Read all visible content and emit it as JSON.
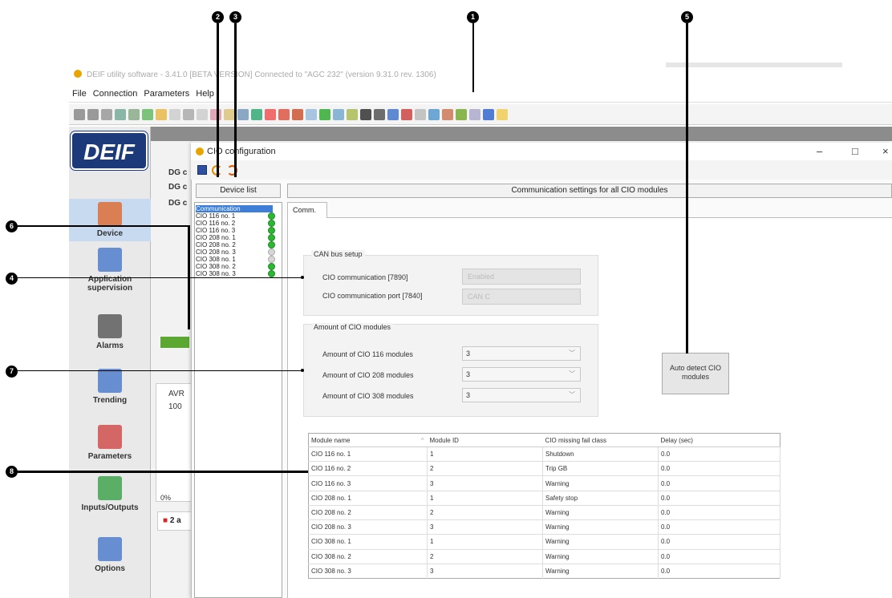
{
  "app": {
    "title": "DEIF utility software - 3.41.0 [BETA VERSION] Connected to \"AGC 232\" (version 9.31.0 rev. 1306)",
    "menu": [
      "File",
      "Connection",
      "Parameters",
      "Help"
    ],
    "logo_text": "DEIF"
  },
  "nav": {
    "items": [
      {
        "label": "Device",
        "icon": "device-icon",
        "active": true
      },
      {
        "label": "Application supervision",
        "icon": "application-supervision-icon",
        "active": false
      },
      {
        "label": "Alarms",
        "icon": "alarms-icon",
        "active": false
      },
      {
        "label": "Trending",
        "icon": "trending-icon",
        "active": false
      },
      {
        "label": "Parameters",
        "icon": "parameters-icon",
        "active": false
      },
      {
        "label": "Inputs/Outputs",
        "icon": "inputs-outputs-icon",
        "active": false
      },
      {
        "label": "Options",
        "icon": "options-icon",
        "active": false
      }
    ]
  },
  "bg_window": {
    "labels": [
      "DG c",
      "DG c",
      "DG c",
      "AVR",
      "100",
      "0%",
      "2 a"
    ]
  },
  "dialog": {
    "title": "CIO configuration",
    "controls": {
      "minimize": "–",
      "maximize": "□",
      "close": "×"
    },
    "device_list_header": "Device list",
    "device_list": [
      {
        "label": "Communication",
        "selected": true,
        "status": null
      },
      {
        "label": "CIO 116 no. 1",
        "selected": false,
        "status": "ok"
      },
      {
        "label": "CIO 116 no. 2",
        "selected": false,
        "status": "ok"
      },
      {
        "label": "CIO 116 no. 3",
        "selected": false,
        "status": "ok"
      },
      {
        "label": "CIO 208 no. 1",
        "selected": false,
        "status": "ok"
      },
      {
        "label": "CIO 208 no. 2",
        "selected": false,
        "status": "ok"
      },
      {
        "label": "CIO 208 no. 3",
        "selected": false,
        "status": "off"
      },
      {
        "label": "CIO 308 no. 1",
        "selected": false,
        "status": "off"
      },
      {
        "label": "CIO 308 no. 2",
        "selected": false,
        "status": "ok"
      },
      {
        "label": "CIO 308 no. 3",
        "selected": false,
        "status": "ok"
      }
    ],
    "comm_header": "Communication settings for all CIO modules",
    "tab": "Comm.",
    "can_bus": {
      "title": "CAN bus setup",
      "comm_label": "CIO communication [7890]",
      "comm_value": "Enabled",
      "port_label": "CIO communication port [7840]",
      "port_value": "CAN C"
    },
    "amount": {
      "title": "Amount of CIO modules",
      "rows": [
        {
          "label": "Amount of CIO 116 modules",
          "value": "3"
        },
        {
          "label": "Amount of CIO 208 modules",
          "value": "3"
        },
        {
          "label": "Amount of CIO 308 modules",
          "value": "3"
        }
      ]
    },
    "auto_detect_label": "Auto detect CIO modules",
    "table": {
      "headers": [
        "Module name",
        "Module ID",
        "CIO missing fail class",
        "Delay (sec)"
      ],
      "rows": [
        [
          "CIO 116 no. 1",
          "1",
          "Shutdown",
          "0.0"
        ],
        [
          "CIO 116 no. 2",
          "2",
          "Trip GB",
          "0.0"
        ],
        [
          "CIO 116 no. 3",
          "3",
          "Warning",
          "0.0"
        ],
        [
          "CIO 208 no. 1",
          "1",
          "Safety stop",
          "0.0"
        ],
        [
          "CIO 208 no. 2",
          "2",
          "Warning",
          "0.0"
        ],
        [
          "CIO 208 no. 3",
          "3",
          "Warning",
          "0.0"
        ],
        [
          "CIO 308 no. 1",
          "1",
          "Warning",
          "0.0"
        ],
        [
          "CIO 308 no. 2",
          "2",
          "Warning",
          "0.0"
        ],
        [
          "CIO 308 no. 3",
          "3",
          "Warning",
          "0.0"
        ]
      ]
    }
  },
  "callouts": [
    "1",
    "2",
    "3",
    "4",
    "5",
    "6",
    "7",
    "8"
  ],
  "colors": {
    "logo_blue": "#1c3a7a",
    "status_ok": "#2db534",
    "selection_blue": "#3d7fd8"
  }
}
